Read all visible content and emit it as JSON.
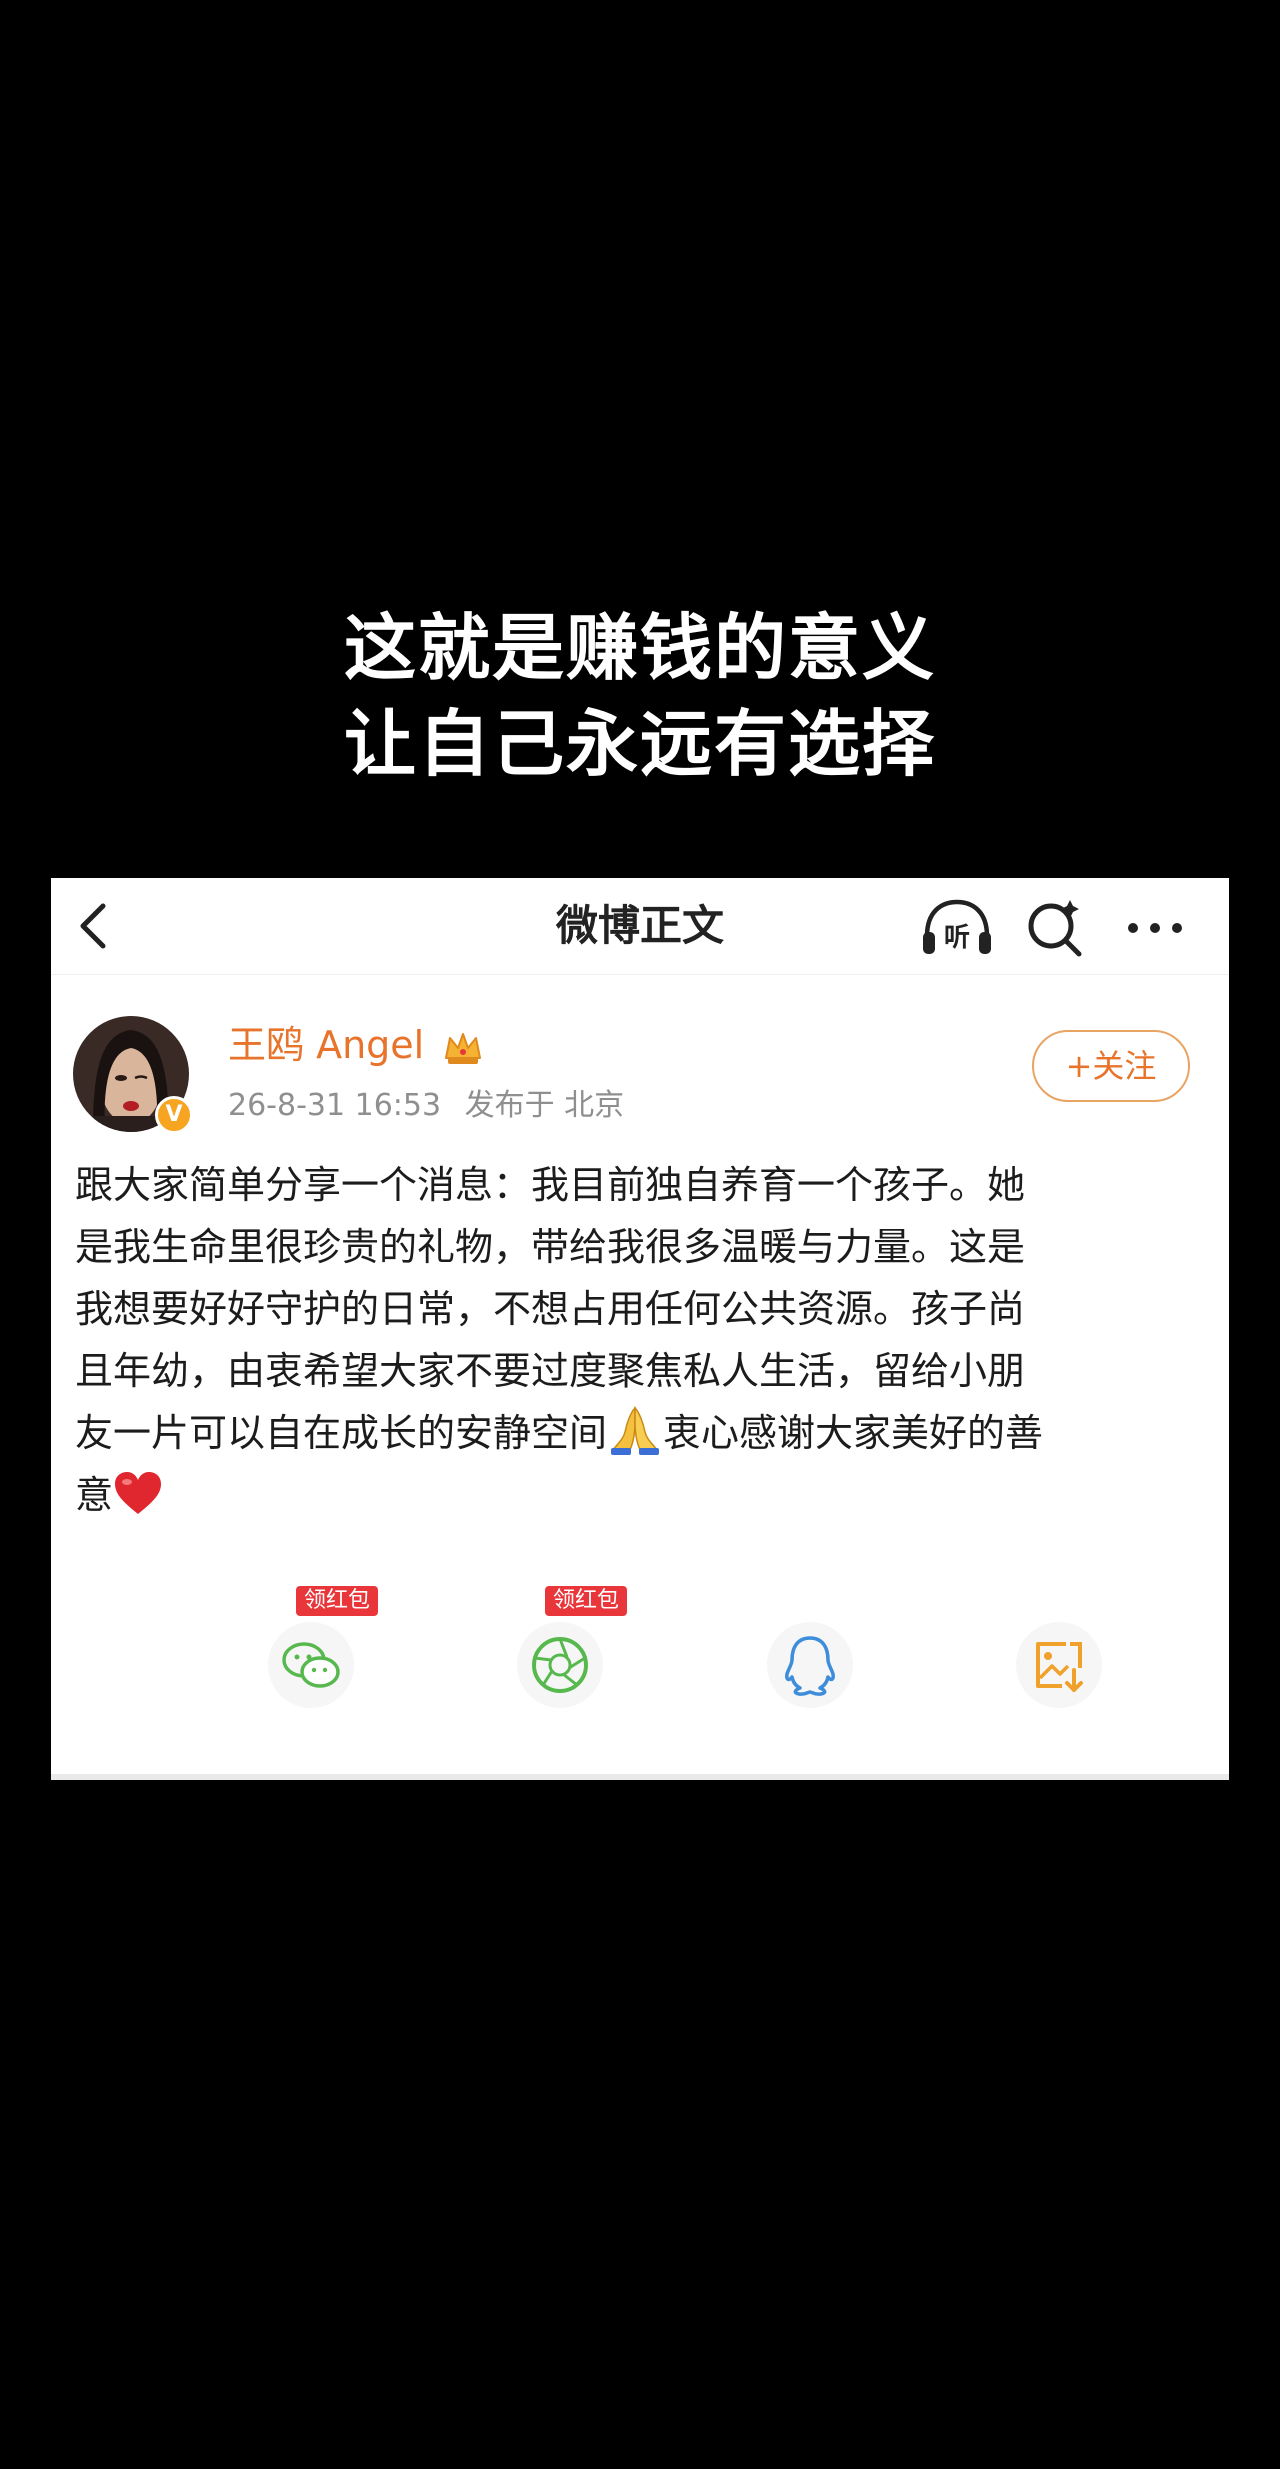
{
  "caption": {
    "line1": "这就是赚钱的意义",
    "line2": "让自己永远有选择"
  },
  "navbar": {
    "title": "微博正文",
    "listen_label": "听",
    "icons": [
      "back-icon",
      "listen-icon",
      "search-icon",
      "more-icon"
    ]
  },
  "post": {
    "username": "王鸥 Angel",
    "verified_badge": "V",
    "timestamp": "26-8-31 16:53",
    "location": "发布于 北京",
    "follow_label": "+关注",
    "lines": [
      "跟大家简单分享一个消息：我目前独自养育一个孩子。她",
      "是我生命里很珍贵的礼物，带给我很多温暖与力量。这是",
      "我想要好好守护的日常，不想占用任何公共资源。孩子尚",
      "且年幼，由衷希望大家不要过度聚焦私人生活，留给小朋",
      "友一片可以自在成长的安静空间",
      "衷心感谢大家美好的善",
      "意"
    ]
  },
  "share": {
    "wechat_tag": "领红包",
    "moments_tag": "领红包",
    "icons": [
      "wechat-icon",
      "moments-icon",
      "qq-icon",
      "save-image-icon"
    ]
  },
  "colors": {
    "accent": "#e8732b",
    "verified": "#f7a421",
    "wechat": "#57b84e",
    "qq": "#3d8ddb",
    "save": "#f0a12c"
  }
}
